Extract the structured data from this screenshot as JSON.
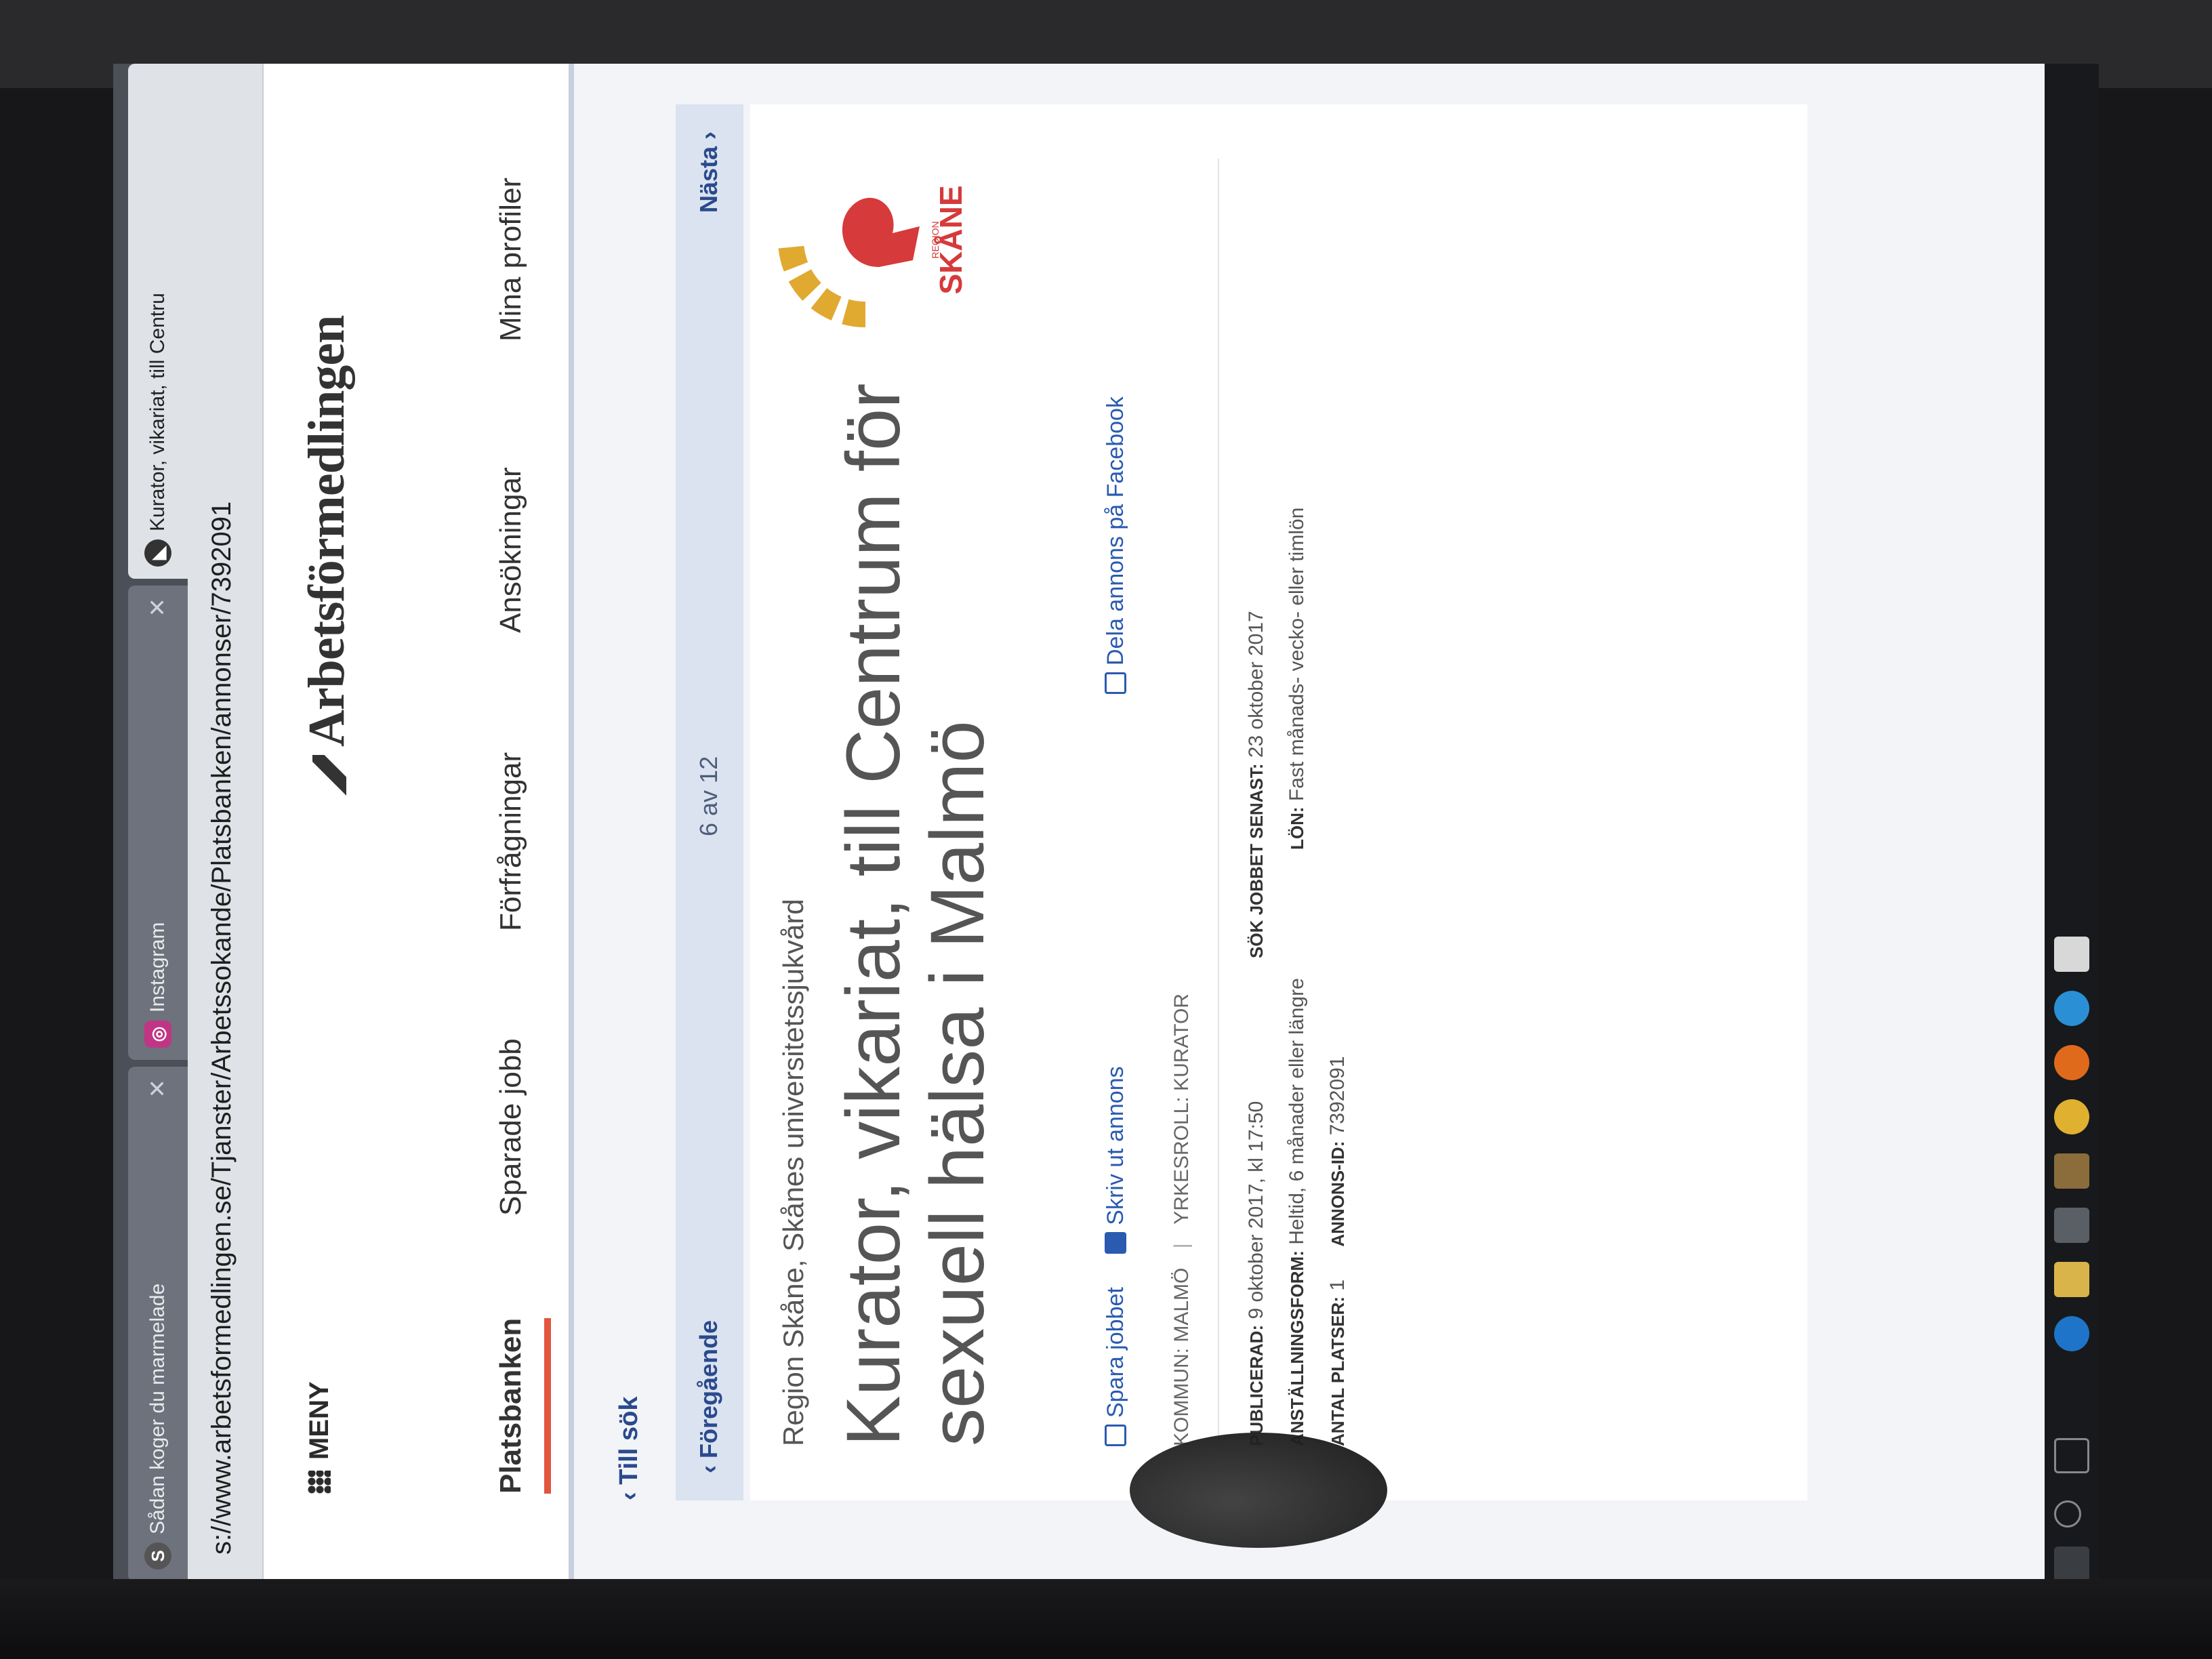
{
  "browser": {
    "tabs": [
      {
        "label": "Sådan koger du marmelade",
        "icon": "s-favicon"
      },
      {
        "label": "Instagram",
        "icon": "instagram-favicon"
      },
      {
        "label": "Kurator, vikariat, till Centru",
        "icon": "af-favicon"
      }
    ],
    "url": "s://www.arbetsformedlingen.se/Tjanster/Arbetssokande/Platsbanken/annonser/7392091"
  },
  "header": {
    "menu_label": "MENY",
    "brand": "Arbetsförmedlingen"
  },
  "nav": {
    "items": [
      "Platsbanken",
      "Sparade jobb",
      "Förfrågningar",
      "Ansökningar",
      "Mina profiler"
    ],
    "active": "Platsbanken"
  },
  "navigation": {
    "back_to_search": "Till sök",
    "previous": "Föregående",
    "position": "6 av 12",
    "next": "Nästa"
  },
  "ad": {
    "employer": "Region Skåne, Skånes universitetssjukvård",
    "title": "Kurator, vikariat, till Centrum för sexuell hälsa i Malmö",
    "logo_text_small": "REGION",
    "logo_text": "SKÅNE",
    "actions": {
      "save": "Spara jobbet",
      "print": "Skriv ut annons",
      "share": "Dela annons på Facebook"
    },
    "kommun_label": "KOMMUN:",
    "kommun": "MALMÖ",
    "yrkesroll_label": "YRKESROLL:",
    "yrkesroll": "KURATOR",
    "publicerad_label": "PUBLICERAD:",
    "publicerad": "9 oktober 2017, kl 17:50",
    "sok_senast_label": "SÖK JOBBET SENAST:",
    "sok_senast": "23 oktober 2017",
    "anstallningsform_label": "ANSTÄLLNINGSFORM:",
    "anstallningsform": "Heltid, 6 månader eller längre",
    "lon_label": "LÖN:",
    "lon": "Fast månads- vecko- eller timlön",
    "antal_platser_label": "ANTAL PLATSER:",
    "antal_platser": "1",
    "annons_id_label": "ANNONS-ID:",
    "annons_id": "7392091"
  },
  "colors": {
    "accent_link": "#2a5bb0",
    "active_tab_underline": "#e2563d",
    "logo_red": "#d63a3a",
    "logo_gold": "#e0a930"
  },
  "taskbar_icons": [
    "windows-icon",
    "search-icon",
    "task-view-icon",
    "edge-icon",
    "file-explorer-icon",
    "store-icon",
    "files-icon",
    "chrome-icon",
    "firefox-icon",
    "ie-icon",
    "mail-icon"
  ]
}
